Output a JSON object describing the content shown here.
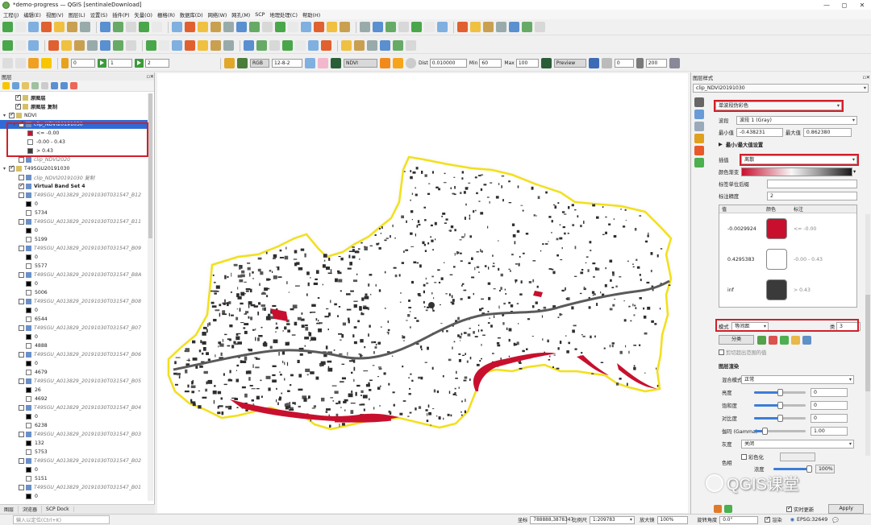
{
  "window": {
    "title": "*demo-progress — QGIS [sentinaleDownload]",
    "min": "—",
    "max": "◻",
    "close": "✕"
  },
  "menu": [
    "工程(J)",
    "编辑(E)",
    "视图(V)",
    "图层(L)",
    "设置(S)",
    "插件(P)",
    "矢量(O)",
    "栅格(R)",
    "数据库(D)",
    "网络(W)",
    "网孔(M)",
    "SCP",
    "地理处理(C)",
    "帮助(H)"
  ],
  "toolbar3": {
    "f1": "0",
    "f2": "1",
    "f3": "2",
    "band_combo": "RGB",
    "band_val": "12-8-2",
    "ndvi": "NDVI",
    "dist_label": "Dist",
    "dist": "0.010000",
    "min_label": "Min",
    "min": "60",
    "max_label": "Max",
    "max": "100",
    "preview": "Preview",
    "t_val": "0",
    "s_val": "200"
  },
  "layers_panel": {
    "title": "图层",
    "items": [
      {
        "name": "原图层",
        "checked": true,
        "kind": "group",
        "bold": true
      },
      {
        "name": "原图层 复制",
        "checked": true,
        "kind": "group",
        "bold": true
      },
      {
        "name": "NDVI",
        "checked": true,
        "kind": "group"
      },
      {
        "name": "clip_NDVI20191030",
        "checked": true,
        "kind": "raster",
        "selected": true
      },
      {
        "name": "<= -0.00",
        "kind": "legend",
        "color": "#c8102e"
      },
      {
        "name": "-0.00 - 0.43",
        "kind": "legend",
        "color": "#ffffff"
      },
      {
        "name": "> 0.43",
        "kind": "legend",
        "color": "#3a3a3a"
      },
      {
        "name": "clip_NDVI2020",
        "checked": false,
        "kind": "raster",
        "grey": true
      },
      {
        "name": "T49SGU20191030",
        "checked": true,
        "kind": "group"
      },
      {
        "name": "clip_NDVI20191030 复制",
        "checked": false,
        "kind": "raster",
        "grey": true
      },
      {
        "name": "Virtual Band Set 4",
        "checked": true,
        "kind": "raster",
        "bold": true
      },
      {
        "name": "T49SGU_A013829_20191030T031547_B12",
        "checked": false,
        "kind": "raster",
        "grey": true
      },
      {
        "name": "0",
        "kind": "val",
        "color": "#000000"
      },
      {
        "name": "5734",
        "kind": "val",
        "color": "#ffffff"
      },
      {
        "name": "T49SGU_A013829_20191030T031547_B11",
        "checked": false,
        "kind": "raster",
        "grey": true
      },
      {
        "name": "0",
        "kind": "val",
        "color": "#000000"
      },
      {
        "name": "5199",
        "kind": "val",
        "color": "#ffffff"
      },
      {
        "name": "T49SGU_A013829_20191030T031547_B09",
        "checked": false,
        "kind": "raster",
        "grey": true
      },
      {
        "name": "0",
        "kind": "val",
        "color": "#000000"
      },
      {
        "name": "5577",
        "kind": "val",
        "color": "#ffffff"
      },
      {
        "name": "T49SGU_A013829_20191030T031547_B8A",
        "checked": false,
        "kind": "raster",
        "grey": true
      },
      {
        "name": "0",
        "kind": "val",
        "color": "#000000"
      },
      {
        "name": "5006",
        "kind": "val",
        "color": "#ffffff"
      },
      {
        "name": "T49SGU_A013829_20191030T031547_B08",
        "checked": false,
        "kind": "raster",
        "grey": true
      },
      {
        "name": "0",
        "kind": "val",
        "color": "#000000"
      },
      {
        "name": "6544",
        "kind": "val",
        "color": "#ffffff"
      },
      {
        "name": "T49SGU_A013829_20191030T031547_B07",
        "checked": false,
        "kind": "raster",
        "grey": true
      },
      {
        "name": "0",
        "kind": "val",
        "color": "#000000"
      },
      {
        "name": "4888",
        "kind": "val",
        "color": "#ffffff"
      },
      {
        "name": "T49SGU_A013829_20191030T031547_B06",
        "checked": false,
        "kind": "raster",
        "grey": true
      },
      {
        "name": "0",
        "kind": "val",
        "color": "#000000"
      },
      {
        "name": "4679",
        "kind": "val",
        "color": "#ffffff"
      },
      {
        "name": "T49SGU_A013829_20191030T031547_B05",
        "checked": false,
        "kind": "raster",
        "grey": true
      },
      {
        "name": "26",
        "kind": "val",
        "color": "#000000"
      },
      {
        "name": "4692",
        "kind": "val",
        "color": "#ffffff"
      },
      {
        "name": "T49SGU_A013829_20191030T031547_B04",
        "checked": false,
        "kind": "raster",
        "grey": true
      },
      {
        "name": "0",
        "kind": "val",
        "color": "#000000"
      },
      {
        "name": "6238",
        "kind": "val",
        "color": "#ffffff"
      },
      {
        "name": "T49SGU_A013829_20191030T031547_B03",
        "checked": false,
        "kind": "raster",
        "grey": true
      },
      {
        "name": "132",
        "kind": "val",
        "color": "#000000"
      },
      {
        "name": "5753",
        "kind": "val",
        "color": "#ffffff"
      },
      {
        "name": "T49SGU_A013829_20191030T031547_B02",
        "checked": false,
        "kind": "raster",
        "grey": true
      },
      {
        "name": "0",
        "kind": "val",
        "color": "#000000"
      },
      {
        "name": "5151",
        "kind": "val",
        "color": "#ffffff"
      },
      {
        "name": "T49SGU_A013829_20191030T031547_B01",
        "checked": false,
        "kind": "raster",
        "grey": true
      },
      {
        "name": "0",
        "kind": "val",
        "color": "#000000"
      }
    ],
    "tabs": [
      "图层",
      "浏览器",
      "SCP Dock"
    ]
  },
  "style_panel": {
    "title": "图层样式",
    "layer": "clip_NDVI20191030",
    "renderer": "单波段伪彩色",
    "band_label": "波段",
    "band": "波段 1 (Gray)",
    "min_label": "最小值",
    "min": "-0.438231",
    "max_label": "最大值",
    "max": "0.862380",
    "minmax_settings": "最小/最大值设置",
    "interp_label": "插值",
    "interp": "离散",
    "ramp_label": "颜色渐变",
    "unit_label": "标签单位后缀",
    "precision_label": "标注精度",
    "precision": "2",
    "table_headers": [
      "值",
      "颜色",
      "标注"
    ],
    "entries": [
      {
        "value": "-0.0029924",
        "color": "#c8102e",
        "label": "<= -0.00"
      },
      {
        "value": "0.4295383",
        "color": "#ffffff",
        "label": "-0.00 - 0.43"
      },
      {
        "value": "inf",
        "color": "#3a3a3a",
        "label": "> 0.43"
      }
    ],
    "mode_label": "模式",
    "mode": "等间距",
    "classes_label": "类",
    "classes": "3",
    "classify_btn": "分类",
    "clip_label": "剪切超出范围的值",
    "layer_render_title": "图层渲染",
    "blend_label": "混合模式",
    "blend": "正常",
    "brightness_label": "亮度",
    "brightness": "0",
    "saturation_label": "饱和度",
    "saturation": "0",
    "contrast_label": "对比度",
    "contrast": "0",
    "gamma_label": "伽玛 (Gamma)",
    "gamma": "1.00",
    "grayscale_label": "灰度",
    "grayscale": "关闭",
    "colorize_label": "彩色化",
    "hue_label": "色相",
    "strength_label": "浓度",
    "strength": "100%",
    "live_update": "实时更新",
    "apply": "Apply"
  },
  "statusbar": {
    "locator_placeholder": "输入以定位(Ctrl+K)",
    "coord_label": "坐标",
    "coord": "788888,3878347",
    "scale_label": "比例尺",
    "scale": "1:209783",
    "magnifier_label": "放大镜",
    "magnifier": "100%",
    "rotation_label": "旋转角度",
    "rotation": "0.0°",
    "render_label": "渲染",
    "crs": "EPSG:32649"
  },
  "watermark": "QGIS课堂"
}
